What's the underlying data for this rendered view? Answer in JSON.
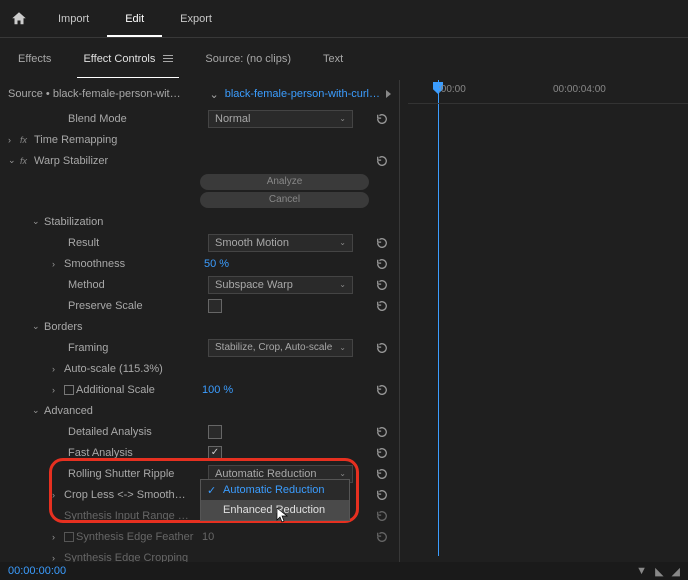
{
  "topnav": {
    "home": "Home",
    "import": "Import",
    "edit": "Edit",
    "export": "Export"
  },
  "subnav": {
    "effects": "Effects",
    "effect_controls": "Effect Controls",
    "source": "Source: (no clips)",
    "text": "Text"
  },
  "clip": {
    "source_prefix": "Source • ",
    "source_name": "black-female-person-wit…",
    "caret": "⌄",
    "link": "black-female-person-with-curl…"
  },
  "timeline": {
    "t0": ":00:00",
    "t1": "00:00:04:00"
  },
  "props": {
    "blend_mode": {
      "label": "Blend Mode",
      "value": "Normal"
    },
    "time_remapping": "Time Remapping",
    "warp": "Warp Stabilizer",
    "analyze": "Analyze",
    "cancel": "Cancel",
    "stabilization": "Stabilization",
    "result": {
      "label": "Result",
      "value": "Smooth Motion"
    },
    "smoothness": {
      "label": "Smoothness",
      "value": "50 %"
    },
    "method": {
      "label": "Method",
      "value": "Subspace Warp"
    },
    "preserve_scale": "Preserve Scale",
    "borders": "Borders",
    "framing": {
      "label": "Framing",
      "value": "Stabilize, Crop, Auto-scale"
    },
    "autoscale": "Auto-scale (115.3%)",
    "additional_scale": {
      "label": "Additional Scale",
      "value": "100 %"
    },
    "advanced": "Advanced",
    "detailed_analysis": "Detailed Analysis",
    "fast_analysis": "Fast Analysis",
    "rolling_shutter": {
      "label": "Rolling Shutter Ripple",
      "value": "Automatic Reduction"
    },
    "crop_smooth": "Crop Less <-> Smooth…",
    "synth_range": "Synthesis Input Range …",
    "synth_feather": {
      "label": "Synthesis Edge Feather",
      "value": "10"
    },
    "synth_crop": "Synthesis Edge Cropping"
  },
  "dd_menu": {
    "opt1": "Automatic Reduction",
    "opt2": "Enhanced Reduction"
  },
  "footer": {
    "timecode": "00:00:00:00"
  }
}
